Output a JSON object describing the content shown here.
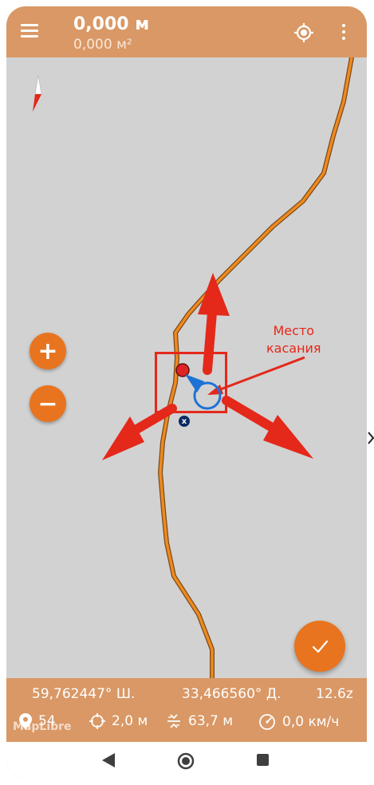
{
  "topbar": {
    "distance": "0,000 м",
    "area": "0,000 м²",
    "icons": {
      "menu": "menu-icon",
      "locate": "crosshair-icon",
      "more": "more-vert-icon"
    }
  },
  "map": {
    "annotation_line1": "Место",
    "annotation_line2": "касания",
    "zoom_in": "+",
    "zoom_out": "−",
    "marker_label": "x",
    "colors": {
      "track": "#f08a1e",
      "annotation": "#e4281a",
      "accent": "#e8741f",
      "bar": "#d99866"
    }
  },
  "status": {
    "latitude": "59,762447° Ш.",
    "longitude": "33,466560° Д.",
    "zoom": "12.6z",
    "satellites": "54",
    "accuracy": "2,0 м",
    "altitude": "63,7 м",
    "speed": "0,0 км/ч",
    "attribution": "MapLibre"
  }
}
